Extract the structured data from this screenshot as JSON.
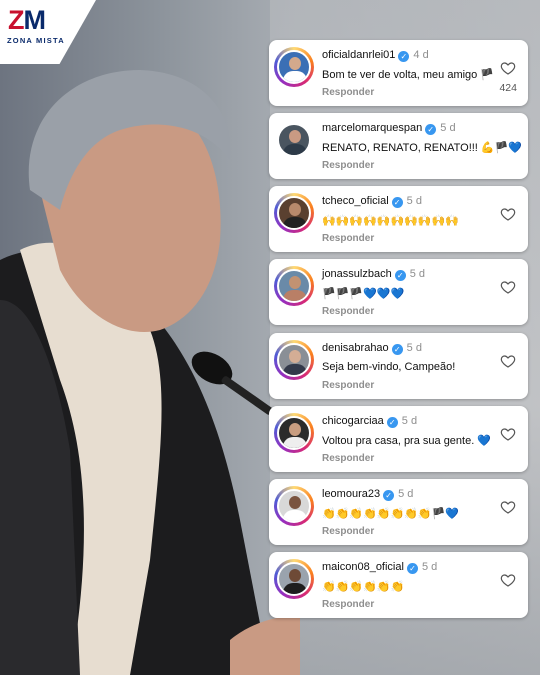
{
  "brand": {
    "logo_text_z": "Z",
    "logo_text_m": "M",
    "logo_sub": "ZONA MISTA"
  },
  "colors": {
    "brand_red": "#c8102e",
    "brand_blue": "#0a2a6b",
    "verified": "#3897f0"
  },
  "comments": [
    {
      "username": "oficialdanrlei01",
      "time": "4 d",
      "text": "Bom te ver de volta, meu amigo 🏴",
      "reply": "Responder",
      "likes": "424"
    },
    {
      "username": "marcelomarquespan",
      "time": "5 d",
      "text": "RENATO, RENATO, RENATO!!! 💪🏴💙",
      "reply": "Responder",
      "likes": ""
    },
    {
      "username": "tcheco_oficial",
      "time": "5 d",
      "text": "🙌🙌🙌🙌🙌🙌🙌🙌🙌🙌",
      "reply": "Responder",
      "likes": ""
    },
    {
      "username": "jonassulzbach",
      "time": "5 d",
      "text": "🏴🏴🏴💙💙💙",
      "reply": "Responder",
      "likes": ""
    },
    {
      "username": "denisabrahao",
      "time": "5 d",
      "text": "Seja bem-vindo, Campeão!",
      "reply": "Responder",
      "likes": ""
    },
    {
      "username": "chicogarciaa",
      "time": "5 d",
      "text": "Voltou pra casa, pra sua gente. 💙",
      "reply": "Responder",
      "likes": ""
    },
    {
      "username": "leomoura23",
      "time": "5 d",
      "text": "👏👏👏👏👏👏👏👏🏴💙",
      "reply": "Responder",
      "likes": ""
    },
    {
      "username": "maicon08_oficial",
      "time": "5 d",
      "text": "👏👏👏👏👏👏",
      "reply": "Responder",
      "likes": ""
    }
  ]
}
